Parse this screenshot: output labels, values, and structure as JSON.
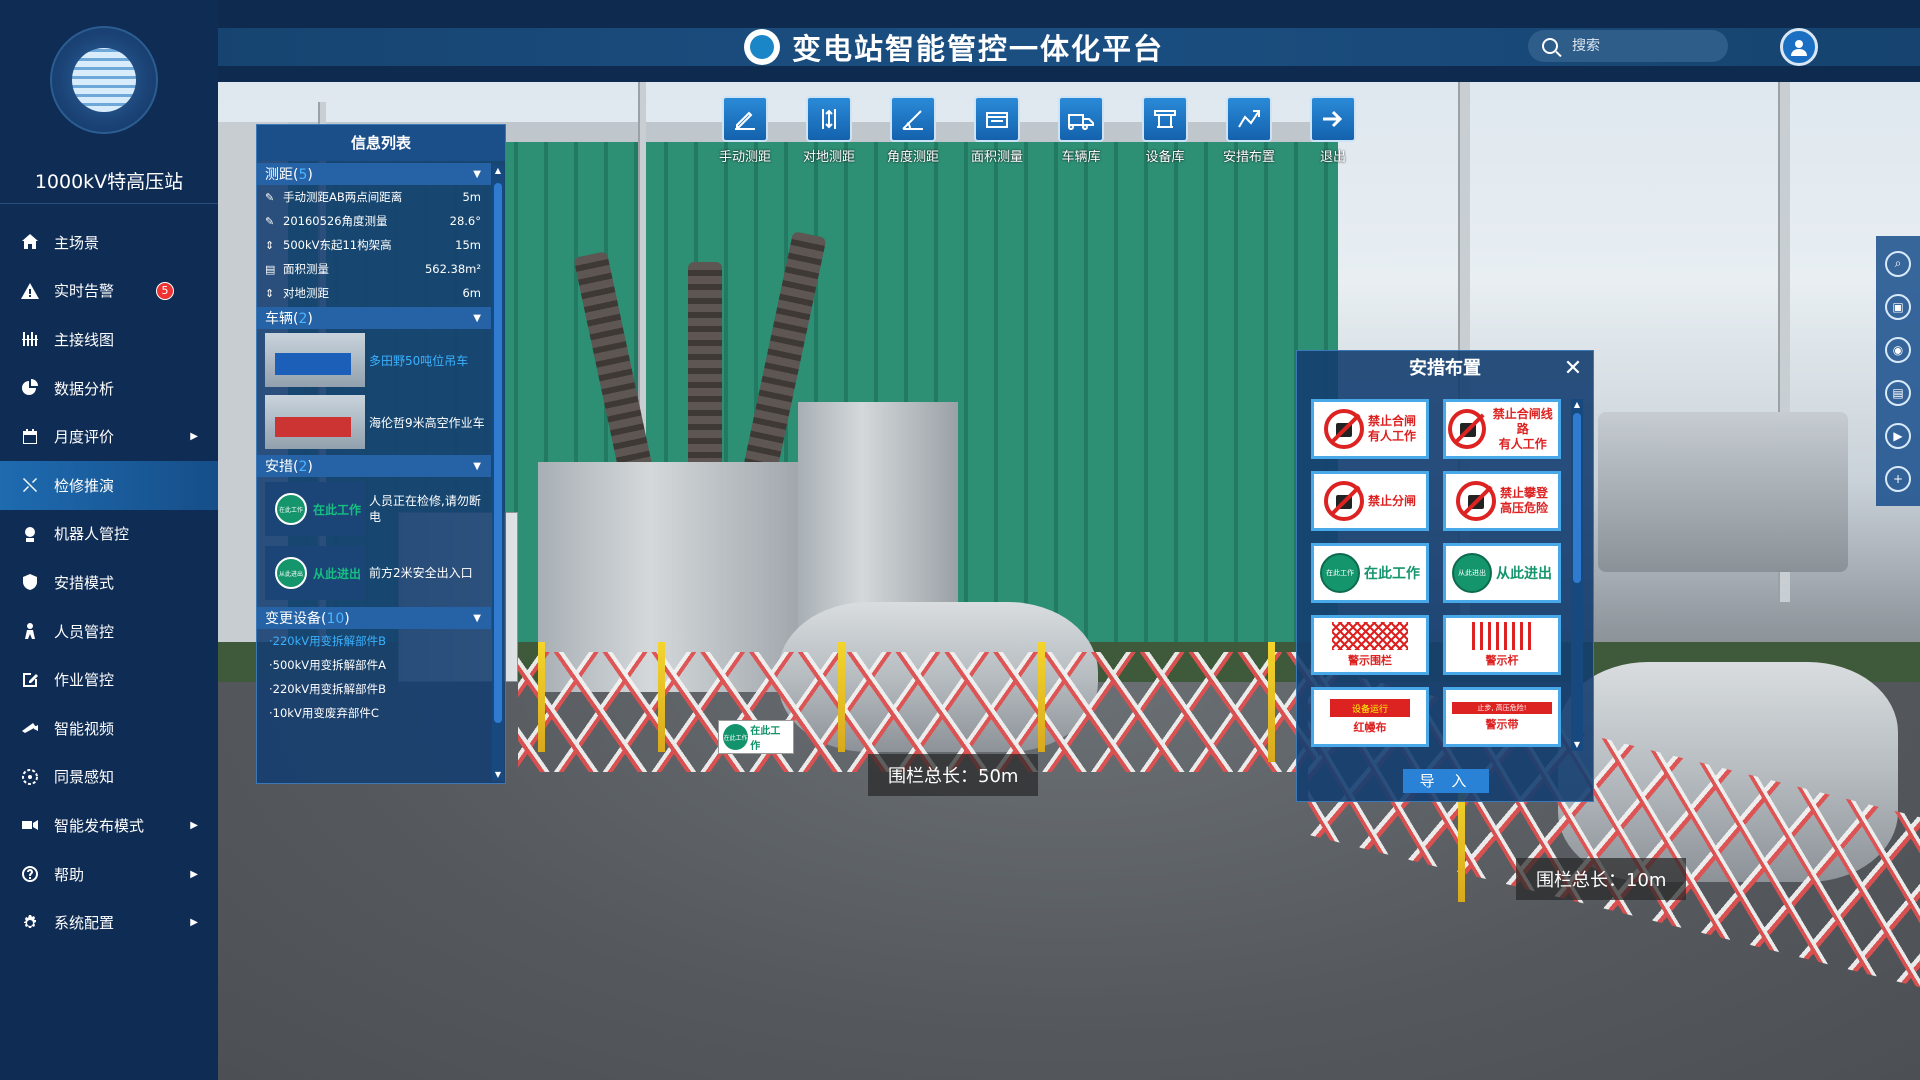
{
  "header": {
    "title": "变电站智能管控一体化平台",
    "search_placeholder": "搜索"
  },
  "sidebar": {
    "station_name": "1000kV特高压站",
    "items": [
      {
        "label": "主场景",
        "icon": "home-icon",
        "arrow": false
      },
      {
        "label": "实时告警",
        "icon": "warning-icon",
        "badge": "5",
        "arrow": false
      },
      {
        "label": "主接线图",
        "icon": "wiring-icon",
        "arrow": false
      },
      {
        "label": "数据分析",
        "icon": "pie-chart-icon",
        "arrow": false
      },
      {
        "label": "月度评价",
        "icon": "calendar-icon",
        "arrow": true
      },
      {
        "label": "检修推演",
        "icon": "wrench-icon",
        "arrow": false,
        "active": true
      },
      {
        "label": "机器人管控",
        "icon": "robot-icon",
        "arrow": false
      },
      {
        "label": "安措模式",
        "icon": "shield-icon",
        "arrow": false
      },
      {
        "label": "人员管控",
        "icon": "person-icon",
        "arrow": false
      },
      {
        "label": "作业管控",
        "icon": "edit-icon",
        "arrow": false
      },
      {
        "label": "智能视频",
        "icon": "camera-icon",
        "arrow": false
      },
      {
        "label": "同景感知",
        "icon": "sensor-icon",
        "arrow": false
      },
      {
        "label": "智能发布模式",
        "icon": "broadcast-icon",
        "arrow": true
      },
      {
        "label": "帮助",
        "icon": "help-icon",
        "arrow": true
      },
      {
        "label": "系统配置",
        "icon": "gear-icon",
        "arrow": true
      }
    ]
  },
  "toolbar": [
    {
      "label": "手动测距",
      "icon": "pen-measure-icon"
    },
    {
      "label": "对地测距",
      "icon": "vertical-measure-icon"
    },
    {
      "label": "角度测距",
      "icon": "angle-measure-icon"
    },
    {
      "label": "面积测量",
      "icon": "area-measure-icon"
    },
    {
      "label": "车辆库",
      "icon": "vehicle-library-icon"
    },
    {
      "label": "设备库",
      "icon": "equipment-library-icon"
    },
    {
      "label": "安措布置",
      "icon": "safety-layout-icon"
    },
    {
      "label": "退出",
      "icon": "exit-arrow-icon"
    }
  ],
  "info_panel": {
    "title": "信息列表",
    "measure": {
      "header": "测距",
      "count": "5",
      "rows": [
        {
          "icon": "pen-icon",
          "name": "手动测距AB两点间距离",
          "value": "5m"
        },
        {
          "icon": "pen-icon",
          "name": "20160526角度测量",
          "value": "28.6°"
        },
        {
          "icon": "vertical-icon",
          "name": "500kV东起11构架高",
          "value": "15m"
        },
        {
          "icon": "area-icon",
          "name": "面积测量",
          "value": "562.38m²"
        },
        {
          "icon": "vertical-icon",
          "name": "对地测距",
          "value": "6m"
        }
      ]
    },
    "vehicles": {
      "header": "车辆",
      "count": "2",
      "rows": [
        {
          "name": "多田野50吨位吊车",
          "selected": true
        },
        {
          "name": "海伦哲9米高空作业车",
          "selected": false
        }
      ]
    },
    "safety": {
      "header": "安措",
      "count": "2",
      "rows": [
        {
          "badge": "在此工作",
          "dot": "在此工作",
          "text": "人员正在检修,请勿断电"
        },
        {
          "badge": "从此进出",
          "dot": "从此进出",
          "text": "前方2米安全出入口"
        }
      ]
    },
    "equipment": {
      "header": "变更设备",
      "count": "10",
      "rows": [
        {
          "name": "·220kV用变拆解部件B",
          "selected": true
        },
        {
          "name": "·500kV用变拆解部件A",
          "selected": false
        },
        {
          "name": "·220kV用变拆解部件B",
          "selected": false
        },
        {
          "name": "·10kV用变废弃部件C",
          "selected": false
        }
      ]
    }
  },
  "safety_panel": {
    "title": "安措布置",
    "signs": [
      {
        "type": "prohibit",
        "text": "禁止合闸\n有人工作"
      },
      {
        "type": "prohibit",
        "text": "禁止合闸线路\n有人工作"
      },
      {
        "type": "prohibit",
        "text": "禁止分闸"
      },
      {
        "type": "prohibit",
        "text": "禁止攀登\n高压危险"
      },
      {
        "type": "green",
        "dot": "在此工作",
        "text": "在此工作"
      },
      {
        "type": "green",
        "dot": "从此进出",
        "text": "从此进出"
      },
      {
        "type": "net",
        "caption": "警示围栏"
      },
      {
        "type": "rods",
        "caption": "警示杆"
      },
      {
        "type": "banner",
        "banner": "设备运行",
        "caption": "红幔布"
      },
      {
        "type": "tape",
        "banner": "止步, 高压危险!",
        "caption": "警示带"
      }
    ],
    "import_label": "导 入"
  },
  "scene": {
    "fence_label_1": "围栏总长：50m",
    "fence_label_2": "围栏总长：10m",
    "sign_dot": "在此工作",
    "sign_text": "在此工作"
  },
  "right_tools": [
    "zoom-search-icon",
    "save-icon",
    "record-icon",
    "screenshot-icon",
    "play-icon",
    "add-icon"
  ],
  "colors": {
    "accent": "#1e6bb0",
    "panel": "#143e70",
    "highlight": "#3bb0ff",
    "danger": "#dd2222",
    "safe_green": "#14956c"
  }
}
